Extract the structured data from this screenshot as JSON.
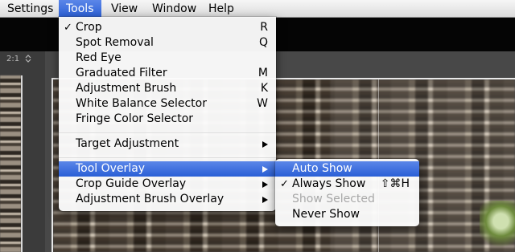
{
  "menubar": {
    "items": [
      {
        "label": "Settings"
      },
      {
        "label": "Tools"
      },
      {
        "label": "View"
      },
      {
        "label": "Window"
      },
      {
        "label": "Help"
      }
    ]
  },
  "left_panel": {
    "zoom_label": "2:1"
  },
  "tools_menu": {
    "items": [
      {
        "label": "Crop",
        "shortcut": "R",
        "checked": true
      },
      {
        "label": "Spot Removal",
        "shortcut": "Q"
      },
      {
        "label": "Red Eye",
        "shortcut": ""
      },
      {
        "label": "Graduated Filter",
        "shortcut": "M"
      },
      {
        "label": "Adjustment Brush",
        "shortcut": "K"
      },
      {
        "label": "White Balance Selector",
        "shortcut": "W"
      },
      {
        "label": "Fringe Color Selector",
        "shortcut": ""
      },
      {
        "label": "Target Adjustment",
        "submenu": true
      },
      {
        "label": "Tool Overlay",
        "submenu": true,
        "highlighted": true
      },
      {
        "label": "Crop Guide Overlay",
        "submenu": true
      },
      {
        "label": "Adjustment Brush Overlay",
        "submenu": true
      }
    ]
  },
  "tool_overlay_submenu": {
    "items": [
      {
        "label": "Auto Show",
        "highlighted": true
      },
      {
        "label": "Always Show",
        "checked": true,
        "shortcut": "⇧⌘H"
      },
      {
        "label": "Show Selected",
        "disabled": true
      },
      {
        "label": "Never Show"
      }
    ]
  },
  "icons": {
    "check": "checkmark-icon",
    "submenu": "chevron-right-icon",
    "stepper": "stepper-icon"
  },
  "colors": {
    "highlight": "#2a5fd6",
    "menubar": "#e8e8e8",
    "disabled_text": "#a8a8a8"
  }
}
